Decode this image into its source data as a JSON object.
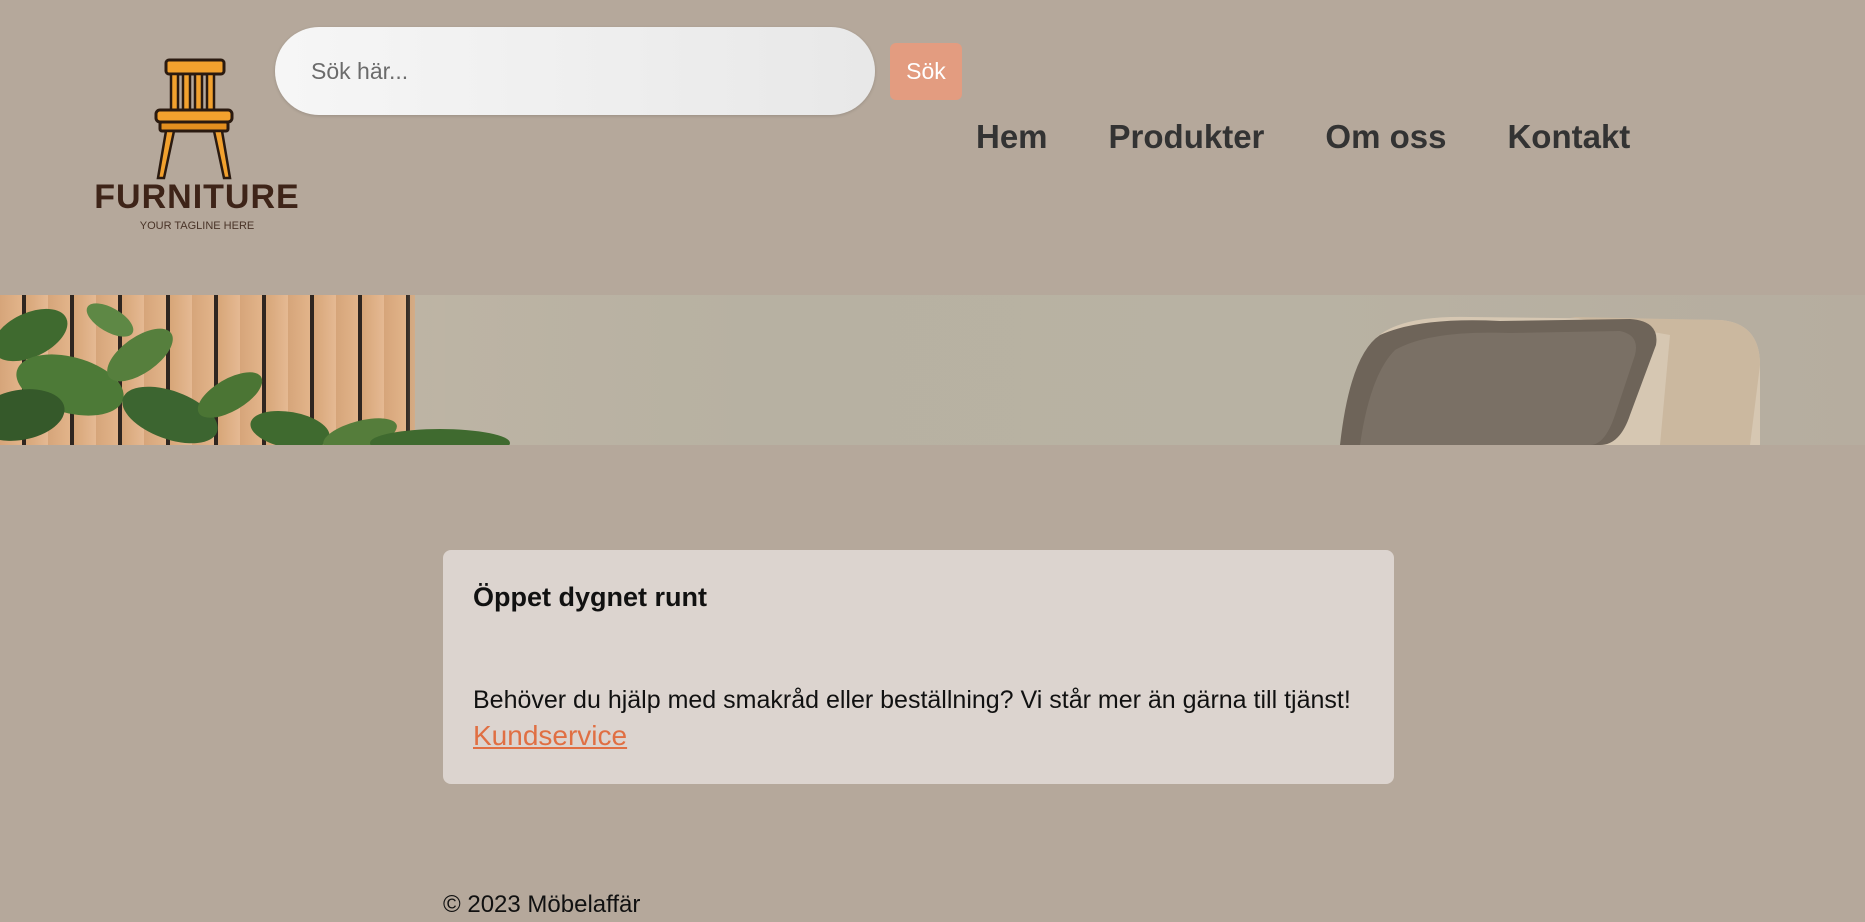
{
  "header": {
    "logo": {
      "title": "FURNITURE",
      "tagline": "YOUR TAGLINE HERE",
      "icon": "chair-icon"
    },
    "search": {
      "placeholder": "Sök här...",
      "button_label": "Sök"
    },
    "nav": {
      "items": [
        {
          "label": "Hem"
        },
        {
          "label": "Produkter"
        },
        {
          "label": "Om oss"
        },
        {
          "label": "Kontakt"
        }
      ]
    }
  },
  "hero": {
    "image": "interior-banner"
  },
  "card": {
    "title": "Öppet dygnet runt",
    "text": "Behöver du hjälp med smakråd eller beställning? Vi står mer än gärna till tjänst!",
    "link_label": "Kundservice"
  },
  "footer": {
    "copyright": "© 2023 Möbelaffär"
  },
  "colors": {
    "background": "#b5a89b",
    "accent": "#e39c80",
    "link": "#e06f43",
    "card": "#dcd4cf",
    "nav_text": "#333333"
  }
}
